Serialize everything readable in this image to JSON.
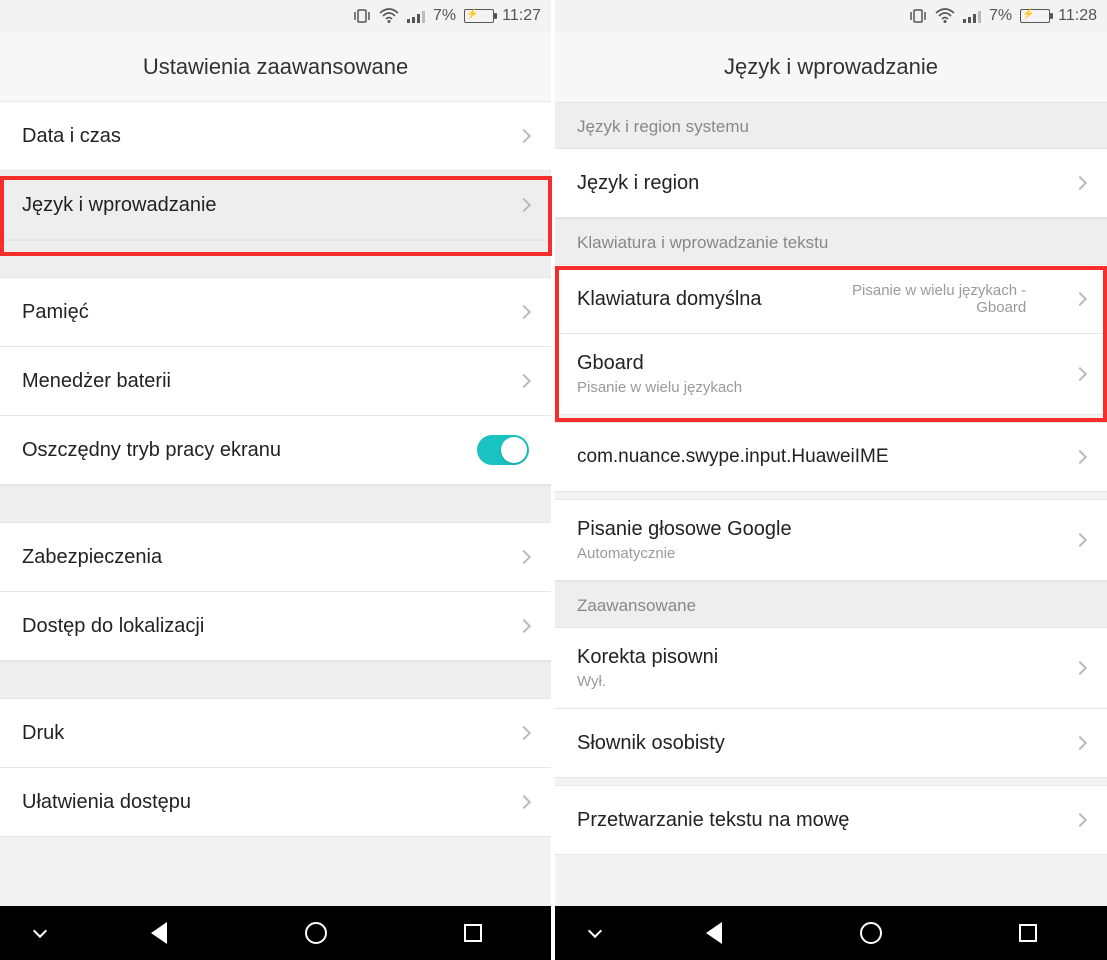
{
  "left": {
    "status": {
      "battery_pct": "7%",
      "time": "11:27"
    },
    "title": "Ustawienia zaawansowane",
    "rows": [
      {
        "label": "Data i czas"
      },
      {
        "label": "Język i wprowadzanie",
        "highlighted": true
      },
      {
        "label": "Pamięć"
      },
      {
        "label": "Menedżer baterii"
      },
      {
        "label": "Oszczędny tryb pracy ekranu",
        "toggle": true,
        "on": true
      },
      {
        "label": "Zabezpieczenia"
      },
      {
        "label": "Dostęp do lokalizacji"
      },
      {
        "label": "Druk"
      },
      {
        "label": "Ułatwienia dostępu"
      }
    ]
  },
  "right": {
    "status": {
      "battery_pct": "7%",
      "time": "11:28"
    },
    "title": "Język i wprowadzanie",
    "sections": {
      "s1": "Język i region systemu",
      "s2": "Klawiatura i wprowadzanie tekstu",
      "s3": "Zaawansowane"
    },
    "rows": {
      "lang_region": {
        "label": "Język i region"
      },
      "default_kb": {
        "label": "Klawiatura domyślna",
        "value": "Pisanie w wielu językach - Gboard"
      },
      "gboard": {
        "label": "Gboard",
        "sub": "Pisanie w wielu językach"
      },
      "huawei": {
        "label": "com.nuance.swype.input.HuaweiIME"
      },
      "voice": {
        "label": "Pisanie głosowe Google",
        "sub": "Automatycznie"
      },
      "spell": {
        "label": "Korekta pisowni",
        "sub": "Wył."
      },
      "dict": {
        "label": "Słownik osobisty"
      },
      "tts": {
        "label": "Przetwarzanie tekstu na mowę"
      }
    }
  }
}
